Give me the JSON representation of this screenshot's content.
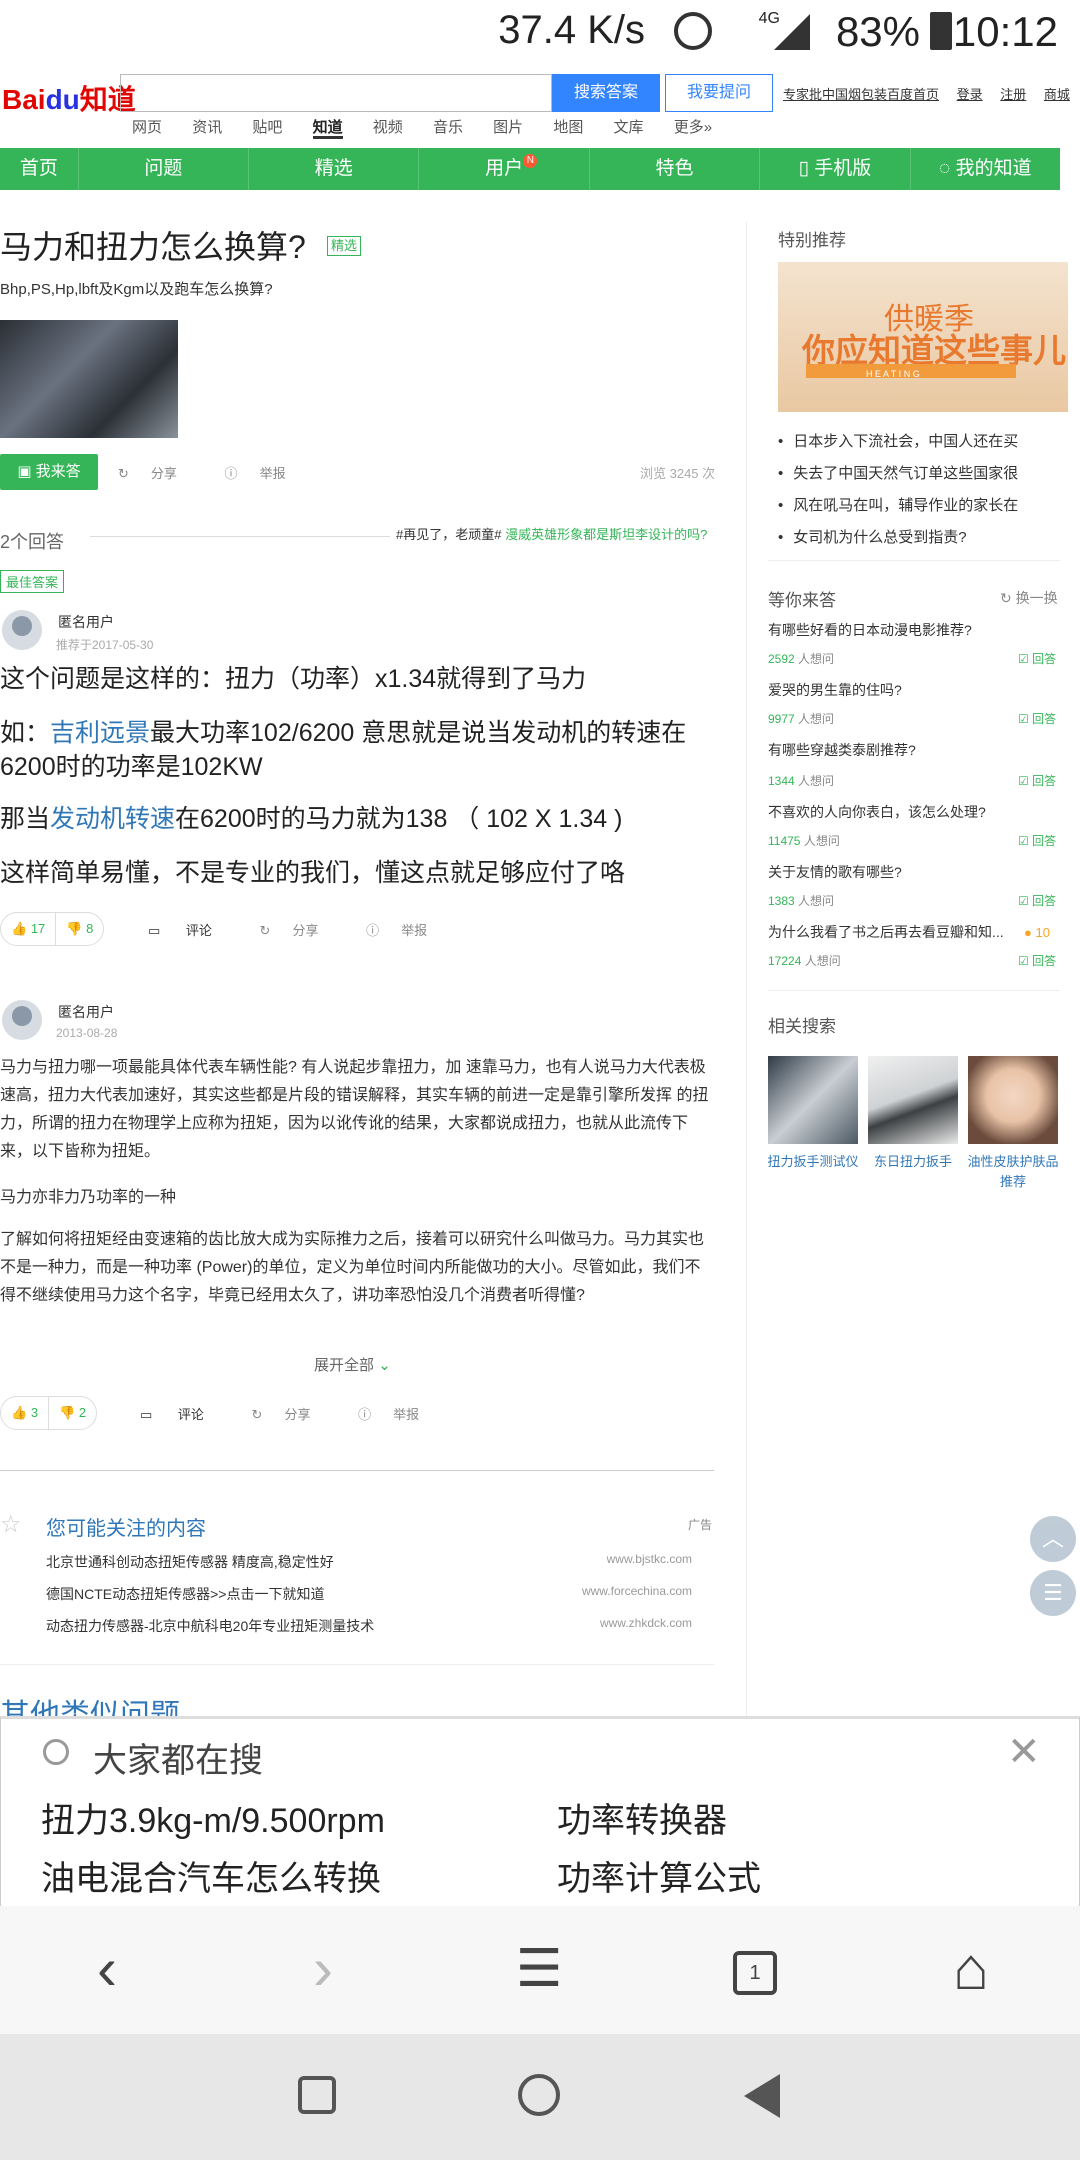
{
  "status_bar": {
    "speed": "37.4 K/s",
    "network": "4G",
    "battery": "83%",
    "time": "10:12"
  },
  "header": {
    "logo_text": "Bai",
    "logo_paw": "du",
    "logo_suffix": "知道",
    "search_button": "搜索答案",
    "ask_button": "我要提问",
    "links": [
      "专家批中国烟包装百度首页",
      "登录",
      "注册",
      "商城"
    ],
    "sub_nav": [
      "网页",
      "资讯",
      "贴吧",
      "知道",
      "视频",
      "音乐",
      "图片",
      "地图",
      "文库",
      "更多»"
    ],
    "sub_nav_active": "知道"
  },
  "green_nav": {
    "items": [
      "首页",
      "问题",
      "精选",
      "用户",
      "特色",
      "手机版",
      "我的知道"
    ],
    "user_badge": "N"
  },
  "question": {
    "title": "马力和扭力怎么换算?",
    "tag": "精选",
    "description": "Bhp,PS,Hp,lbft及Kgm以及跑车怎么换算?",
    "answer_button": "我来答",
    "share": "分享",
    "report": "举报",
    "views": "浏览 3245 次"
  },
  "answers_header": {
    "count": "2个回答",
    "hot_prefix": "#再见了，老顽童#",
    "hot_link": "漫威英雄形象都是斯坦李设计的吗?",
    "best_tag": "最佳答案"
  },
  "answer1": {
    "user": "匿名用户",
    "meta": "推荐于2017-05-30",
    "p1": "这个问题是这样的：扭力（功率）x1.34就得到了马力",
    "p2_a": "如：",
    "p2_link": "吉利远景",
    "p2_b": "最大功率102/6200 意思就是说当发动机的转速在6200时的功率是102KW",
    "p3_a": "那当",
    "p3_link": "发动机转速",
    "p3_b": "在6200时的马力就为138 （ 102 X 1.34 )",
    "p4": "这样简单易懂，不是专业的我们，懂这点就足够应付了咯",
    "up": "17",
    "down": "8",
    "comment": "评论",
    "share": "分享",
    "report": "举报"
  },
  "answer2": {
    "user": "匿名用户",
    "meta": "2013-08-28",
    "p1": "马力与扭力哪一项最能具体代表车辆性能? 有人说起步靠扭力，加 速靠马力，也有人说马力大代表极速高，扭力大代表加速好，其实这些都是片段的错误解释，其实车辆的前进一定是靠引擎所发挥 的扭力，所谓的扭力在物理学上应称为扭矩，因为以讹传讹的结果，大家都说成扭力，也就从此流传下来，以下皆称为扭矩。",
    "p2": "马力亦非力乃功率的一种",
    "p3": "了解如何将扭矩经由变速箱的齿比放大成为实际推力之后，接着可以研究什么叫做马力。马力其实也不是一种力，而是一种功率 (Power)的单位，定义为单位时间内所能做功的大小。尽管如此，我们不得不继续使用马力这个名字，毕竟已经用太久了，讲功率恐怕没几个消费者听得懂?",
    "expand": "展开全部",
    "up": "3",
    "down": "2",
    "comment": "评论",
    "share": "分享",
    "report": "举报"
  },
  "ads": {
    "title": "您可能关注的内容",
    "tag": "广告",
    "rows": [
      {
        "text": "北京世通科创动态扭矩传感器 精度高,稳定性好",
        "url": "www.bjstkc.com"
      },
      {
        "text": "德国NCTE动态扭矩传感器>>点击一下就知道",
        "url": "www.forcechina.com"
      },
      {
        "text": "动态扭力传感器-北京中航科电20年专业扭矩测量技术",
        "url": "www.zhkdck.com"
      }
    ]
  },
  "similar_title": "其他类似问题",
  "sidebar": {
    "featured_title": "特别推荐",
    "ad_line1": "供暖季",
    "ad_line2": "你应知道这些事儿",
    "ad_bar": "H E A T I N G",
    "featured": [
      "日本步入下流社会，中国人还在买",
      "失去了中国天然气订单这些国家很",
      "风在吼马在叫，辅导作业的家长在",
      "女司机为什么总受到指责?"
    ],
    "wait_title": "等你来答",
    "refresh": "换一换",
    "answer_label": "回答",
    "people_label": "人想问",
    "wait_questions": [
      {
        "q": "有哪些好看的日本动漫电影推荐?",
        "count": "2592"
      },
      {
        "q": "爱哭的男生靠的住吗?",
        "count": "9977"
      },
      {
        "q": "有哪些穿越类泰剧推荐?",
        "count": "1344"
      },
      {
        "q": "不喜欢的人向你表白，该怎么处理?",
        "count": "11475"
      },
      {
        "q": "关于友情的歌有哪些?",
        "count": "1383"
      },
      {
        "q": "为什么我看了书之后再去看豆瓣和知...",
        "count": "17224"
      }
    ],
    "coin": "10",
    "related_title": "相关搜索",
    "related": [
      "扭力扳手测试仪",
      "东日扭力扳手",
      "油性皮肤护肤品推荐"
    ]
  },
  "suggest": {
    "title": "大家都在搜",
    "items": [
      "扭力3.9kg-m/9.500rpm",
      "功率转换器",
      "油电混合汽车怎么转换",
      "功率计算公式"
    ]
  },
  "browser_bar": {
    "tab_count": "1"
  }
}
